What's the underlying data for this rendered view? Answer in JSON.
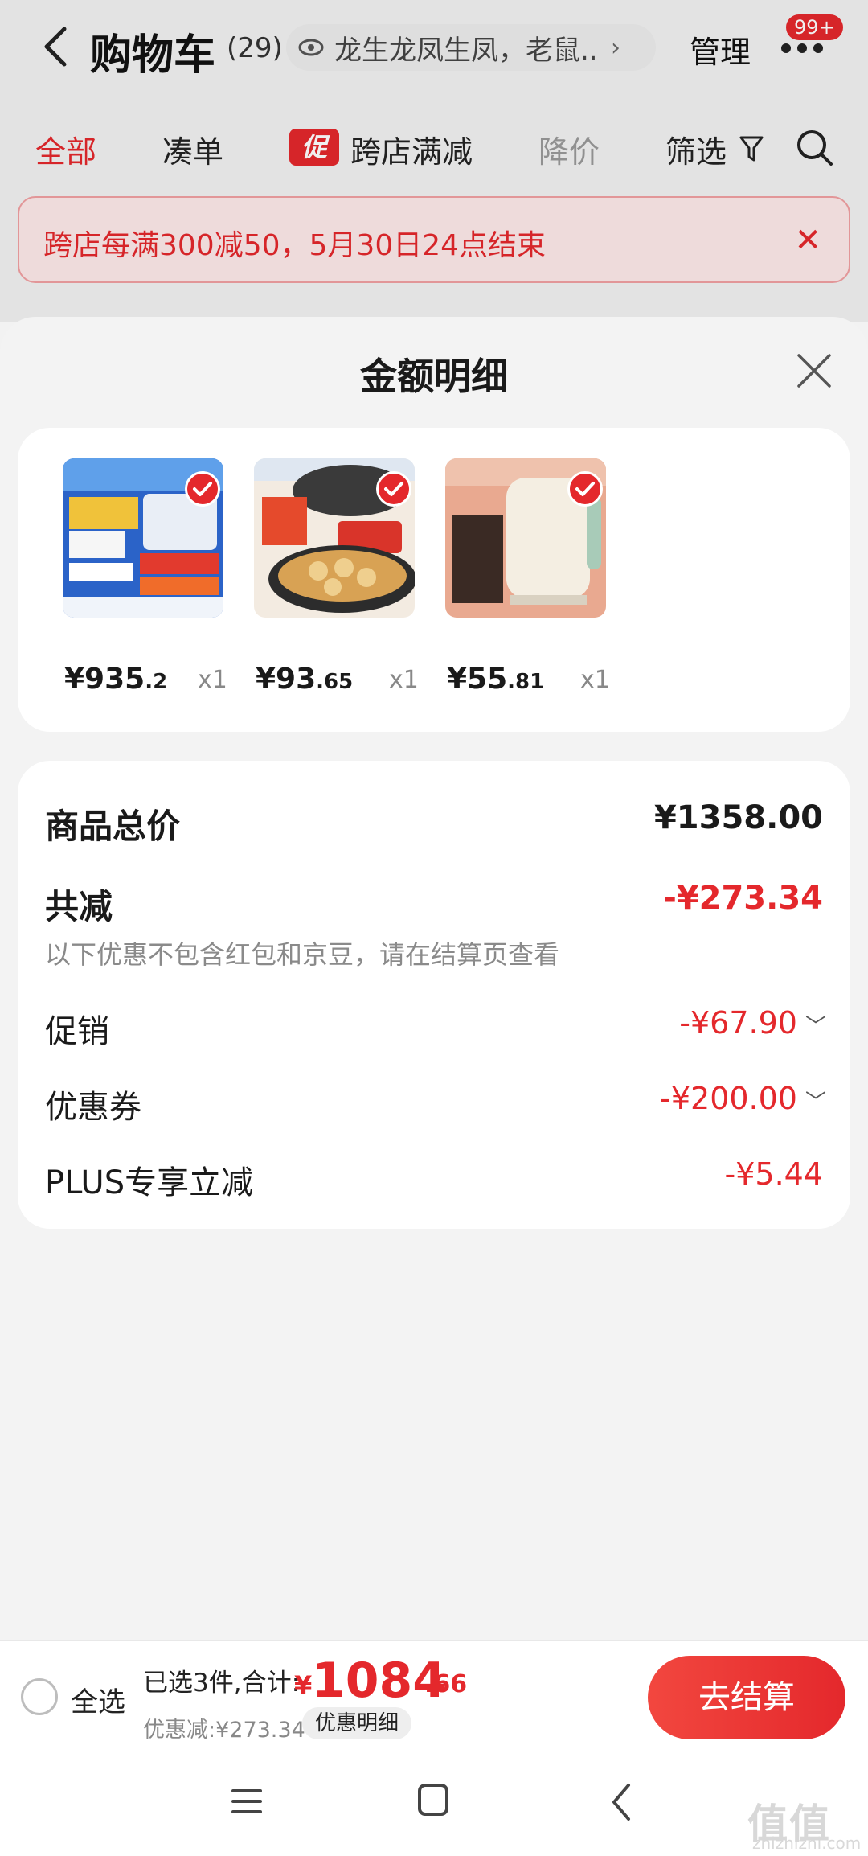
{
  "header": {
    "title": "购物车",
    "count": "(29)",
    "search_text": "龙生龙凤生凤，老鼠...",
    "manage_label": "管理",
    "badge": "99+"
  },
  "tabs": [
    {
      "label": "全部"
    },
    {
      "label": "凑单"
    },
    {
      "label": "跨店满减",
      "tag": "促"
    },
    {
      "label": "降价"
    },
    {
      "label": "筛选"
    }
  ],
  "banner": {
    "text": "跨店每满300减50，5月30日24点结束",
    "close": "✕"
  },
  "sheet": {
    "title": "金额明细",
    "products": [
      {
        "price_int": "¥935",
        "price_dec": ".2",
        "qty": "x1"
      },
      {
        "price_int": "¥93",
        "price_dec": ".65",
        "qty": "x1"
      },
      {
        "price_int": "¥55",
        "price_dec": ".81",
        "qty": "x1"
      }
    ],
    "summary": {
      "total_label": "商品总价",
      "total_value": "¥1358.00",
      "reduce_label": "共减",
      "reduce_value": "-¥273.34",
      "note": "以下优惠不包含红包和京豆，请在结算页查看",
      "promo_label": "促销",
      "promo_value": "-¥67.90",
      "coupon_label": "优惠券",
      "coupon_value": "-¥200.00",
      "plus_label": "PLUS专享立减",
      "plus_value": "-¥5.44"
    }
  },
  "checkout": {
    "select_all": "全选",
    "selected_text": "已选3件,合计:",
    "total_currency": "¥",
    "total_int": "1084",
    "total_dec": ".66",
    "discount_text": "优惠减:¥273.34",
    "detail_chip": "优惠明细",
    "pay_label": "去结算"
  },
  "watermark": {
    "text": "值值值",
    "sub": "zhizhizhi.com"
  },
  "colors": {
    "accent": "#e4282c",
    "muted": "#8a8a8a"
  }
}
